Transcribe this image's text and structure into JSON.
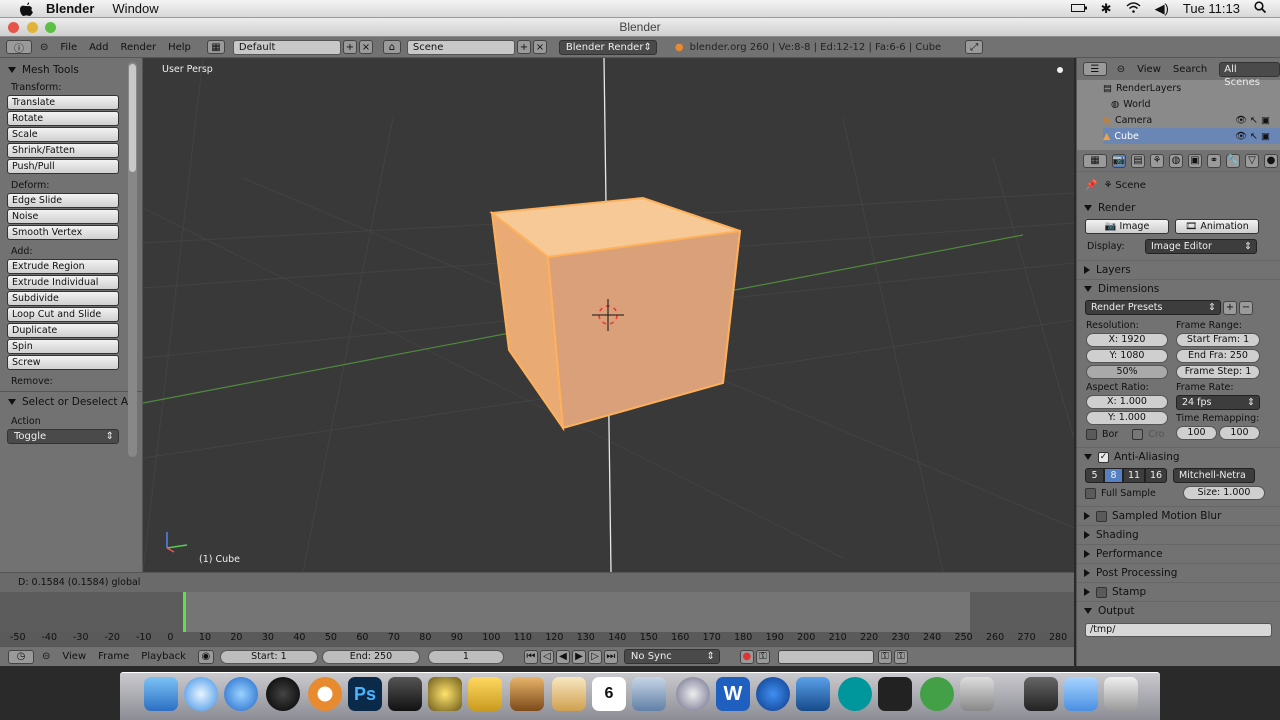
{
  "macmenu": {
    "app": "Blender",
    "window": "Window",
    "clock": "Tue 11:13"
  },
  "window_title": "Blender",
  "header": {
    "menus": [
      "File",
      "Add",
      "Render",
      "Help"
    ],
    "layout": "Default",
    "scene": "Scene",
    "engine": "Blender Render",
    "stats": "blender.org 260 | Ve:8-8 | Ed:12-12 | Fa:6-6 | Cube"
  },
  "toolshelf": {
    "title": "Mesh Tools",
    "transform_label": "Transform:",
    "transform": [
      "Translate",
      "Rotate",
      "Scale",
      "Shrink/Fatten",
      "Push/Pull"
    ],
    "deform_label": "Deform:",
    "deform": [
      "Edge Slide",
      "Noise",
      "Smooth Vertex"
    ],
    "add_label": "Add:",
    "add": [
      "Extrude Region",
      "Extrude Individual",
      "Subdivide",
      "Loop Cut and Slide",
      "Duplicate",
      "Spin",
      "Screw"
    ],
    "remove_label": "Remove:",
    "op_title": "Select or Deselect All",
    "action_label": "Action",
    "action_value": "Toggle"
  },
  "viewport": {
    "view_name": "User Persp",
    "object_label": "(1) Cube",
    "status": "D: 0.1584 (0.1584) global"
  },
  "timeline": {
    "ticks": [
      "-50",
      "-40",
      "-30",
      "-20",
      "-10",
      "0",
      "10",
      "20",
      "30",
      "40",
      "50",
      "60",
      "70",
      "80",
      "90",
      "100",
      "110",
      "120",
      "130",
      "140",
      "150",
      "160",
      "170",
      "180",
      "190",
      "200",
      "210",
      "220",
      "230",
      "240",
      "250",
      "260",
      "270",
      "280"
    ],
    "menus": [
      "View",
      "Frame",
      "Playback"
    ],
    "start": "Start: 1",
    "end": "End: 250",
    "current": "1",
    "sync": "No Sync",
    "current_frame": 0
  },
  "outliner": {
    "menus": [
      "View",
      "Search",
      "All Scenes"
    ],
    "items": [
      "RenderLayers",
      "World",
      "Camera",
      "Cube"
    ]
  },
  "properties": {
    "context": "Scene",
    "render": {
      "title": "Render",
      "image_btn": "Image",
      "anim_btn": "Animation",
      "display_label": "Display:",
      "display_value": "Image Editor"
    },
    "layers": "Layers",
    "dimensions": {
      "title": "Dimensions",
      "presets": "Render Presets",
      "resolution_label": "Resolution:",
      "res_x": "X: 1920",
      "res_y": "Y: 1080",
      "res_pct": "50%",
      "frame_range_label": "Frame Range:",
      "start": "Start Fram: 1",
      "end": "End Fra: 250",
      "step": "Frame Step: 1",
      "aspect_label": "Aspect Ratio:",
      "asp_x": "X: 1.000",
      "asp_y": "Y: 1.000",
      "frame_rate_label": "Frame Rate:",
      "fps": "24 fps",
      "remap_label": "Time Remapping:",
      "remap_old": "100",
      "remap_new": "100",
      "bor": "Bor",
      "cro": "Cro"
    },
    "aa": {
      "title": "Anti-Aliasing",
      "samples": [
        "5",
        "8",
        "11",
        "16"
      ],
      "filter": "Mitchell-Netra",
      "full_sample": "Full Sample",
      "size": "Size: 1.000"
    },
    "sections": [
      "Sampled Motion Blur",
      "Shading",
      "Performance",
      "Post Processing",
      "Stamp",
      "Output"
    ],
    "output_path": "/tmp/"
  },
  "colors": {
    "accent": "#5680c2",
    "object": "#f3b77a",
    "grid_x": "#7a3a3a",
    "grid_y": "#4f8a3d"
  }
}
